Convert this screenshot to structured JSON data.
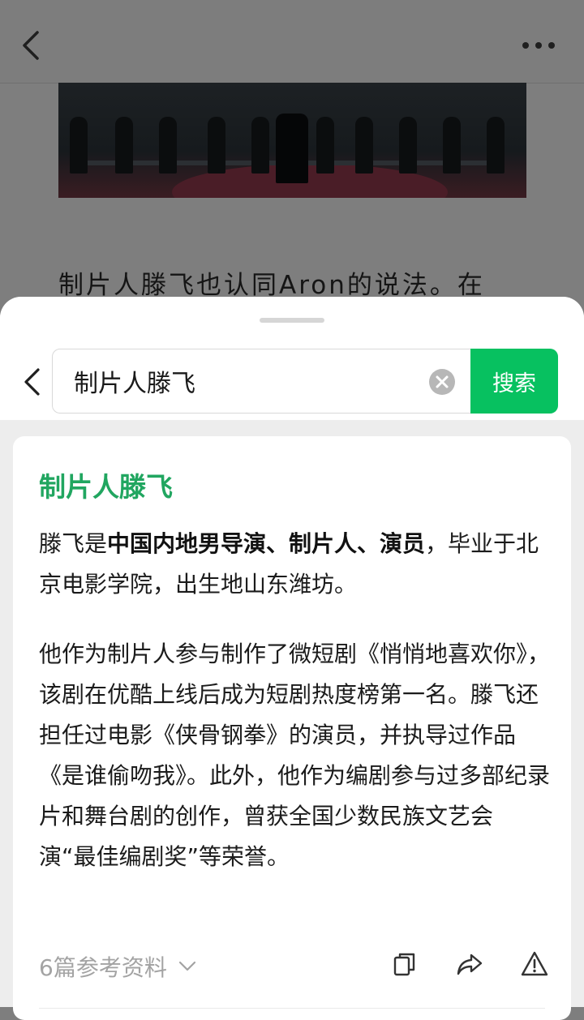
{
  "header": {
    "back_icon": "chevron-left-icon",
    "more_icon": "more-dots-icon"
  },
  "article": {
    "snippet": "制片人滕飞也认同Aron的说法。在"
  },
  "search": {
    "query": "制片人滕飞",
    "button_label": "搜索",
    "clear_icon": "clear-circle-icon"
  },
  "result": {
    "title": "制片人滕飞",
    "para1_prefix": "滕飞是",
    "para1_bold": "中国内地男导演、制片人、演员",
    "para1_suffix": "，毕业于北京电影学院，出生地山东潍坊。",
    "para2": "他作为制片人参与制作了微短剧《悄悄地喜欢你》，该剧在优酷上线后成为短剧热度榜第一名。滕飞还担任过电影《侠骨钢拳》的演员，并执导过作品《是谁偷吻我》。此外，他作为编剧参与过多部纪录片和舞台剧的创作，曾获全国少数民族文艺会演“最佳编剧奖”等荣誉。",
    "refs_label": "6篇参考资料",
    "actions": [
      "copy-icon",
      "share-icon",
      "report-icon"
    ]
  },
  "colors": {
    "accent": "#07c160",
    "title_green": "#21a660"
  }
}
